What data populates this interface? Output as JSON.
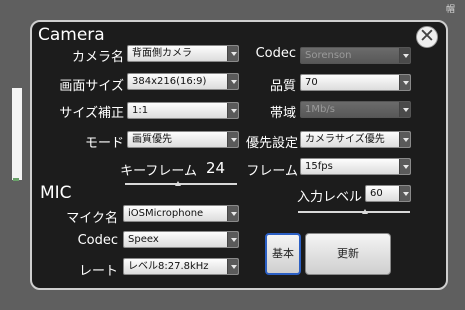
{
  "decor": {
    "right_glyph": "帽"
  },
  "camera": {
    "title": "Camera",
    "camera_name": {
      "label": "カメラ名",
      "value": "背面側カメラ"
    },
    "codec": {
      "label": "Codec",
      "value": "Sorenson",
      "disabled": true
    },
    "resolution": {
      "label": "画面サイズ",
      "value": "384x216(16:9)"
    },
    "quality": {
      "label": "品質",
      "value": "70"
    },
    "size_correction": {
      "label": "サイズ補正",
      "value": "1:1"
    },
    "bandwidth": {
      "label": "帯域",
      "value": "1Mb/s",
      "disabled": true
    },
    "mode": {
      "label": "モード",
      "value": "画質優先"
    },
    "priority": {
      "label": "優先設定",
      "value": "カメラサイズ優先"
    },
    "keyframe": {
      "label": "キーフレーム",
      "value": "24"
    },
    "frame": {
      "label": "フレーム",
      "value": "15fps"
    }
  },
  "mic": {
    "title": "MIC",
    "input_level": {
      "label": "入力レベル",
      "value": "60"
    },
    "mic_name": {
      "label": "マイク名",
      "value": "iOSMicrophone"
    },
    "codec": {
      "label": "Codec",
      "value": "Speex"
    },
    "rate": {
      "label": "レート",
      "value": "レベル8:27.8kHz"
    }
  },
  "buttons": {
    "basic": "基本",
    "update": "更新",
    "close_glyph": "✕"
  }
}
